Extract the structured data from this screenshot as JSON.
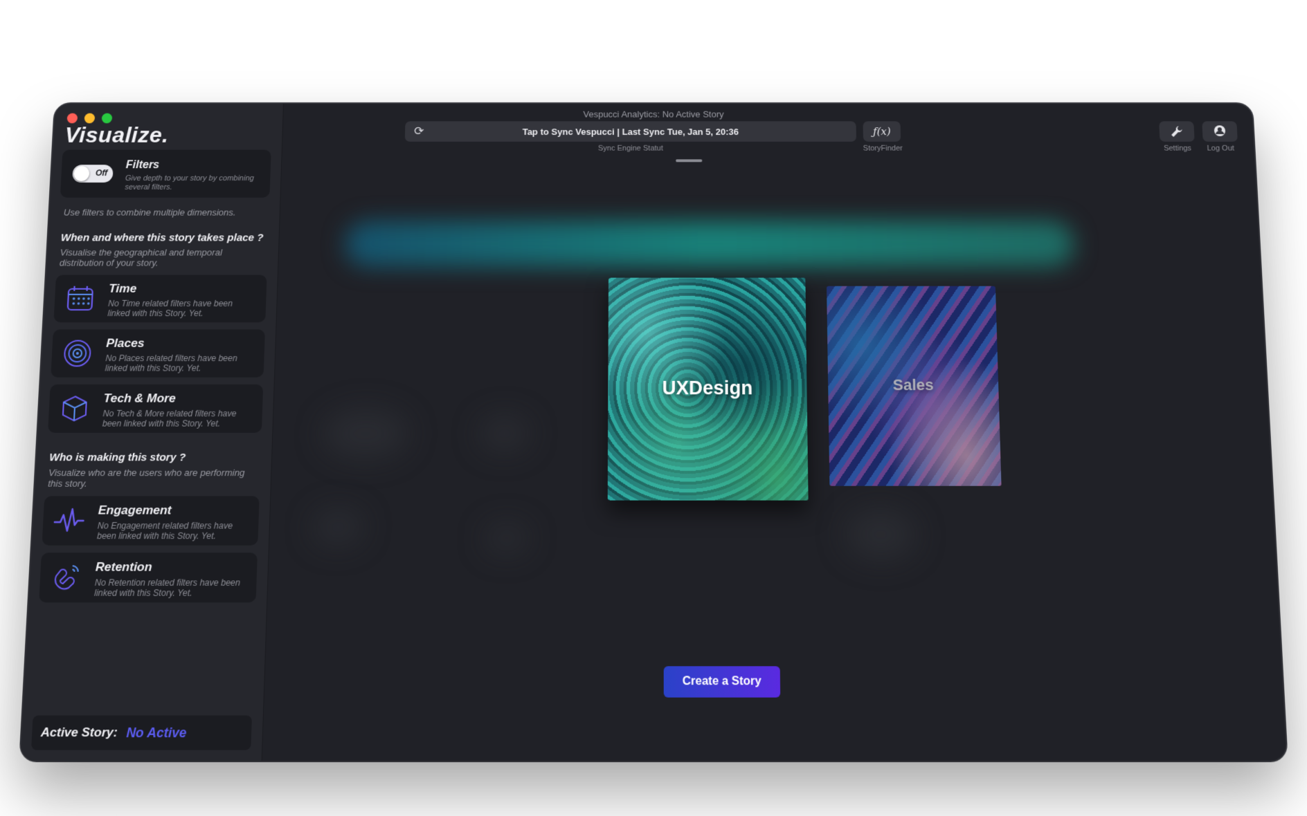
{
  "window": {
    "title": "Vespucci Analytics: No Active Story"
  },
  "sync": {
    "label": "Tap to Sync Vespucci | Last Sync Tue, Jan 5, 20:36",
    "caption": "Sync Engine Statut",
    "icon": "refresh-icon"
  },
  "storyfinder": {
    "label": "ƒ(x)",
    "caption": "StoryFinder"
  },
  "toolbar": {
    "settings_caption": "Settings",
    "logout_caption": "Log Out"
  },
  "sidebar": {
    "brand": "Visualize.",
    "filters": {
      "title": "Filters",
      "description": "Give depth to your story by combining several filters.",
      "toggle_label": "Off",
      "hint": "Use filters to combine multiple dimensions."
    },
    "section_where": {
      "title": "When and where this story takes place ?",
      "description": "Visualise the geographical and temporal distribution of your story."
    },
    "section_who": {
      "title": "Who is making this story ?",
      "description": "Visualize who are the users who are performing this story."
    },
    "categories": [
      {
        "title": "Time",
        "description": "No Time related filters have been linked with this Story. Yet.",
        "icon": "calendar-icon"
      },
      {
        "title": "Places",
        "description": "No Places related filters have been linked with this Story. Yet.",
        "icon": "target-icon"
      },
      {
        "title": "Tech & More",
        "description": "No Tech & More related filters have been linked with this Story. Yet.",
        "icon": "cube-icon"
      },
      {
        "title": "Engagement",
        "description": "No Engagement related filters have been linked with this Story. Yet.",
        "icon": "pulse-icon"
      },
      {
        "title": "Retention",
        "description": "No Retention related filters have been linked with this Story. Yet.",
        "icon": "magnet-icon"
      }
    ],
    "active_story": {
      "label": "Active Story:",
      "value": "No Active"
    }
  },
  "main": {
    "stories": [
      {
        "label": "UXDesign"
      },
      {
        "label": "Sales"
      }
    ],
    "create_button": "Create a Story"
  },
  "colors": {
    "accent": "#5b5cf0",
    "button_gradient_start": "#2a42c8",
    "button_gradient_end": "#5a2ae0",
    "background": "#202127"
  }
}
